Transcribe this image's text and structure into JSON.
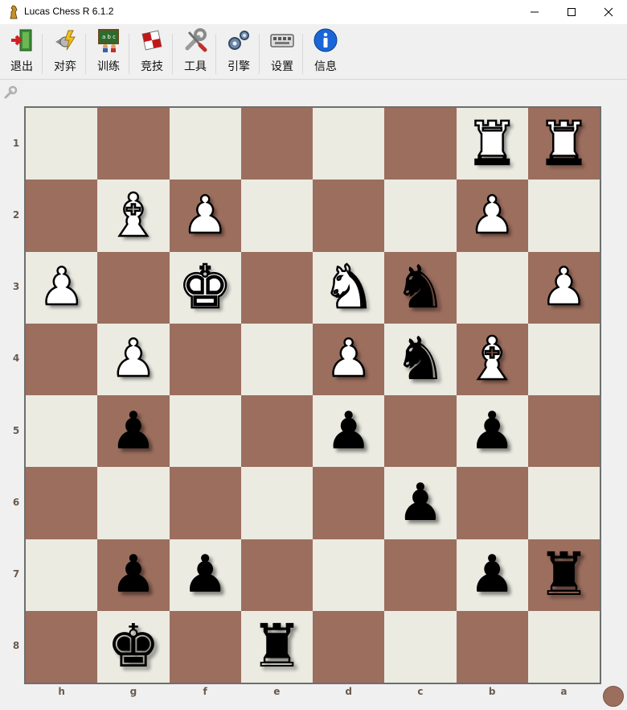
{
  "window": {
    "title": "Lucas Chess R 6.1.2"
  },
  "toolbar": [
    {
      "label": "退出",
      "icon": "exit-icon"
    },
    {
      "label": "对弈",
      "icon": "play-icon"
    },
    {
      "label": "训练",
      "icon": "train-icon"
    },
    {
      "label": "竞技",
      "icon": "compete-icon"
    },
    {
      "label": "工具",
      "icon": "tools-icon"
    },
    {
      "label": "引擎",
      "icon": "engines-icon"
    },
    {
      "label": "设置",
      "icon": "settings-icon"
    },
    {
      "label": "信息",
      "icon": "info-icon"
    }
  ],
  "board": {
    "light_color": "#ebebe2",
    "dark_color": "#9c6e5e",
    "ranks": [
      "1",
      "2",
      "3",
      "4",
      "5",
      "6",
      "7",
      "8"
    ],
    "files": [
      "h",
      "g",
      "f",
      "e",
      "d",
      "c",
      "b",
      "a"
    ],
    "rows": [
      [
        "",
        "",
        "",
        "",
        "",
        "",
        "R",
        "R"
      ],
      [
        "",
        "B",
        "P",
        "",
        "",
        "",
        "P",
        ""
      ],
      [
        "P",
        "",
        "K",
        "",
        "N",
        "n",
        "",
        "P"
      ],
      [
        "",
        "P",
        "",
        "",
        "P",
        "n",
        "B",
        ""
      ],
      [
        "",
        "p",
        "",
        "",
        "p",
        "",
        "p",
        ""
      ],
      [
        "",
        "",
        "",
        "",
        "",
        "p",
        "",
        ""
      ],
      [
        "",
        "p",
        "p",
        "",
        "",
        "",
        "p",
        "r"
      ],
      [
        "",
        "k",
        "",
        "r",
        "",
        "",
        "",
        ""
      ]
    ]
  },
  "side_to_move_color": "#9c6e5e"
}
